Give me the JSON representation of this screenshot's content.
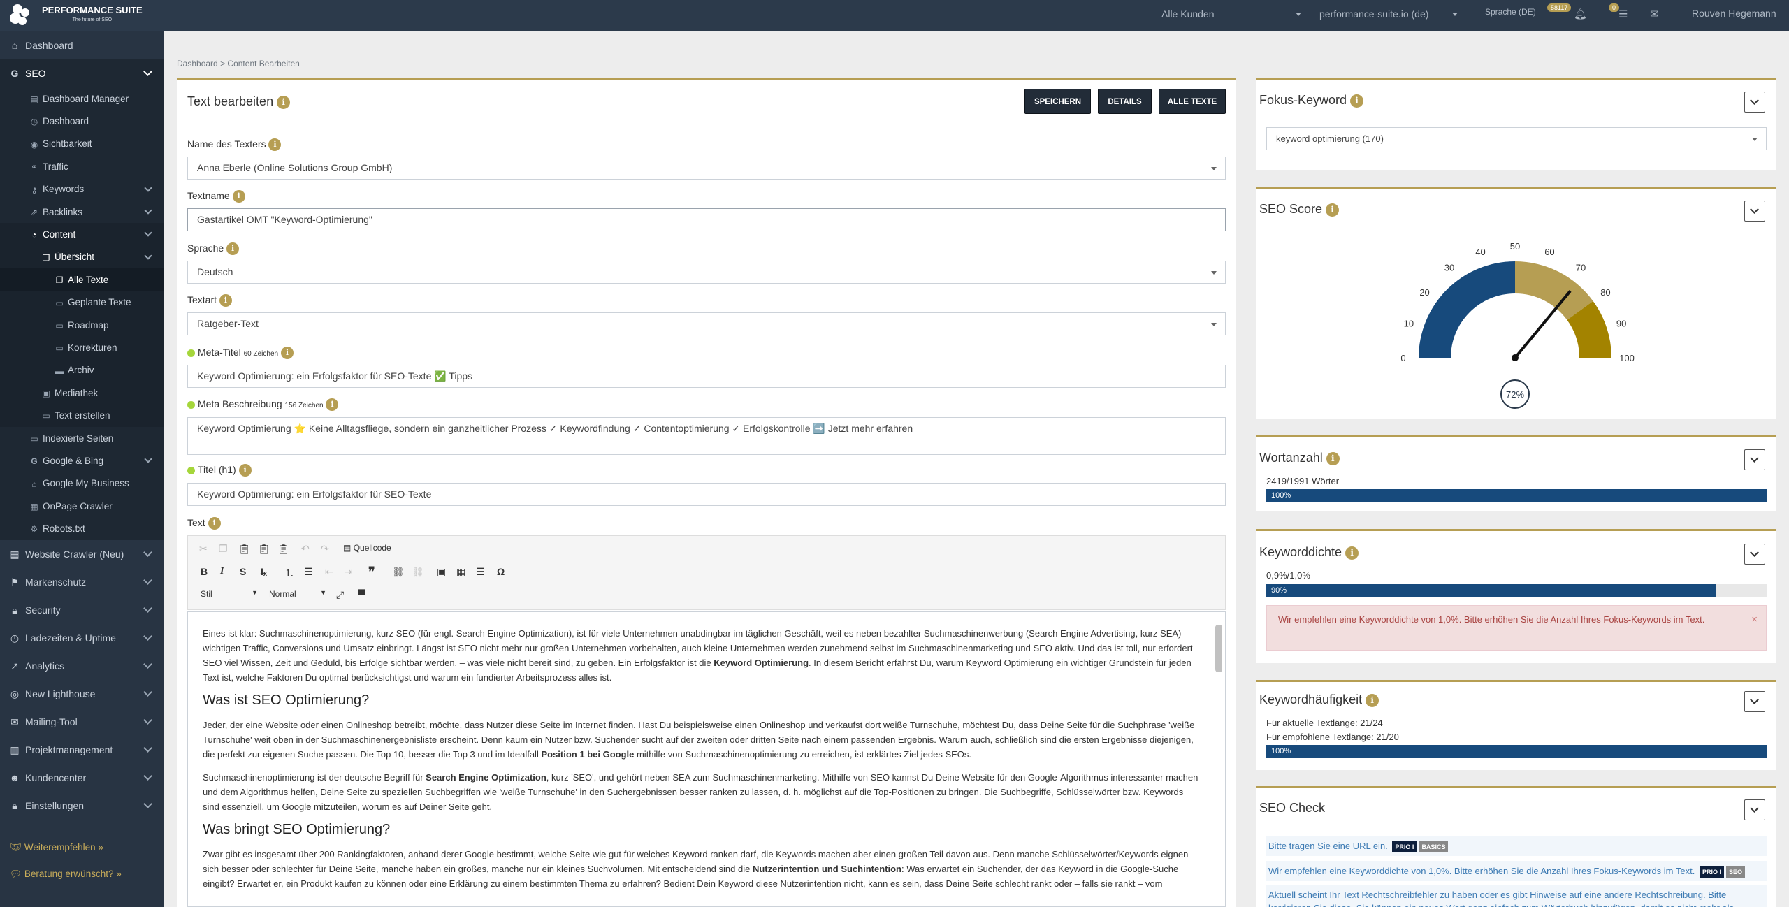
{
  "topbar": {
    "brand": "PERFORMANCE SUITE",
    "tagline": "The future of SEO",
    "customer_select": "Alle Kunden",
    "domain_select": "performance-suite.io (de)",
    "language": "Sprache (DE)",
    "bell_badge": "58117",
    "tasks_badge": "0",
    "user": "Rouven Hegemann"
  },
  "sidebar": {
    "top": [
      {
        "label": "Dashboard",
        "icon": "home-icon"
      },
      {
        "label": "SEO",
        "icon": "google-icon"
      }
    ],
    "seo_items": [
      {
        "label": "Dashboard Manager",
        "icon": "bars-icon"
      },
      {
        "label": "Dashboard",
        "icon": "gauge-icon"
      },
      {
        "label": "Sichtbarkeit",
        "icon": "eye-icon"
      },
      {
        "label": "Traffic",
        "icon": "traffic-icon"
      },
      {
        "label": "Keywords",
        "icon": "key-icon"
      },
      {
        "label": "Backlinks",
        "icon": "external-link-icon"
      },
      {
        "label": "Content",
        "icon": "clock-icon"
      }
    ],
    "content_items": [
      {
        "label": "Übersicht",
        "icon": "files-icon"
      }
    ],
    "overview_items": [
      {
        "label": "Alle Texte",
        "icon": "files-icon"
      },
      {
        "label": "Geplante Texte",
        "icon": "file-icon"
      },
      {
        "label": "Roadmap",
        "icon": "file-icon"
      },
      {
        "label": "Korrekturen",
        "icon": "file-icon"
      },
      {
        "label": "Archiv",
        "icon": "archive-icon"
      }
    ],
    "content_items2": [
      {
        "label": "Mediathek",
        "icon": "image-icon"
      },
      {
        "label": "Text erstellen",
        "icon": "file-icon"
      }
    ],
    "seo_items2": [
      {
        "label": "Indexierte Seiten",
        "icon": "file-icon"
      },
      {
        "label": "Google & Bing",
        "icon": "google-icon"
      },
      {
        "label": "Google My Business",
        "icon": "store-icon"
      },
      {
        "label": "OnPage Crawler",
        "icon": "table-icon"
      },
      {
        "label": "Robots.txt",
        "icon": "robot-icon"
      }
    ],
    "bottom": [
      {
        "label": "Website Crawler (Neu)",
        "icon": "table-icon"
      },
      {
        "label": "Markenschutz",
        "icon": "flag-icon"
      },
      {
        "label": "Security",
        "icon": "lock-icon"
      },
      {
        "label": "Ladezeiten & Uptime",
        "icon": "gauge-icon"
      },
      {
        "label": "Analytics",
        "icon": "chart-icon"
      },
      {
        "label": "New Lighthouse",
        "icon": "globe-icon"
      },
      {
        "label": "Mailing-Tool",
        "icon": "mail-icon"
      },
      {
        "label": "Projektmanagement",
        "icon": "projects-icon"
      },
      {
        "label": "Kundencenter",
        "icon": "users-icon"
      },
      {
        "label": "Einstellungen",
        "icon": "lock-icon"
      }
    ],
    "recommend": "Weiterempfehlen »",
    "consulting": "Beratung erwünscht? »"
  },
  "breadcrumb": {
    "home": "Dashboard",
    "sep": ">",
    "current": "Content Bearbeiten"
  },
  "editor_card": {
    "title": "Text bearbeiten",
    "save": "SPEICHERN",
    "details": "DETAILS",
    "all_texts": "ALLE TEXTE",
    "writer_label": "Name des Texters",
    "writer_value": "Anna Eberle (Online Solutions Group GmbH)",
    "textname_label": "Textname",
    "textname_value": "Gastartikel OMT \"Keyword-Optimierung\"",
    "language_label": "Sprache",
    "language_value": "Deutsch",
    "texttype_label": "Textart",
    "texttype_value": "Ratgeber-Text",
    "meta_title_label": "Meta-Titel",
    "meta_title_chars": "60 Zeichen",
    "meta_title_value": "Keyword Optimierung: ein Erfolgsfaktor für SEO-Texte ✅ Tipps",
    "meta_desc_label": "Meta Beschreibung",
    "meta_desc_chars": "156 Zeichen",
    "meta_desc_value": "Keyword Optimierung ⭐ Keine Alltagsfliege, sondern ein ganzheitlicher Prozess ✓ Keywordfindung ✓ Contentoptimierung ✓ Erfolgskontrolle ➡️ Jetzt mehr erfahren",
    "h1_label": "Titel (h1)",
    "h1_value": "Keyword Optimierung: ein Erfolgsfaktor für SEO-Texte",
    "text_label": "Text"
  },
  "toolbar": {
    "source": "Quellcode",
    "style": "Stil",
    "format": "Normal"
  },
  "article": {
    "p1a": "Eines ist klar: Suchmaschinenoptimierung, kurz SEO (für engl. Search Engine Optimization), ist für viele Unternehmen unabdingbar im täglichen Geschäft, weil es neben bezahlter Suchmaschinenwerbung (Search Engine Advertising, kurz SEA) wichtigen Traffic, Conversions und Umsatz einbringt. Längst ist SEO nicht mehr nur großen Unternehmen vorbehalten, auch kleine Unternehmen werden zunehmend selbst im Suchmaschinenmarketing und SEO aktiv. Und das ist toll, nur erfordert SEO viel Wissen, Zeit und Geduld, bis Erfolge sichtbar werden, – was viele nicht bereit sind, zu geben. Ein Erfolgsfaktor ist die ",
    "p1b": "Keyword Optimierung",
    "p1c": ". In diesem Bericht erfährst Du, warum Keyword Optimierung ein wichtiger Grundstein für jeden Text ist, welche Faktoren Du optimal berücksichtigst und warum ein fundierter Arbeitsprozess alles ist.",
    "h2a": "Was ist SEO Optimierung?",
    "p2a": "Jeder, der eine Website oder einen Onlineshop betreibt, möchte, dass Nutzer diese Seite im Internet finden. Hast Du beispielsweise einen Onlineshop und verkaufst dort weiße Turnschuhe, möchtest Du, dass Deine Seite für die Suchphrase 'weiße Turnschuhe' weit oben in der Suchmaschinenergebnisliste erscheint. Denn kaum ein Nutzer bzw. Suchender sucht auf der zweiten oder dritten Seite nach einem passenden Ergebnis. Warum auch, schließlich sind die ersten Ergebnisse diejenigen, die perfekt zur eigenen Suche passen. Die Top 10, besser die Top 3 und im Idealfall ",
    "p2b": "Position 1 bei Google",
    "p2c": " mithilfe von Suchmaschinenoptimierung zu erreichen, ist erklärtes Ziel jedes SEOs.",
    "p3a": "Suchmaschinenoptimierung ist der deutsche Begriff für ",
    "p3b": "Search Engine Optimization",
    "p3c": ", kurz 'SEO', und gehört neben SEA zum Suchmaschinenmarketing. Mithilfe von SEO kannst Du Deine Website für den Google-Algorithmus interessanter machen und dem Algorithmus helfen, Deine Seite zu speziellen Suchbegriffen wie 'weiße Turnschuhe' in den Suchergebnissen besser ranken zu lassen, d. h. möglichst auf die Top-Positionen zu bringen. Die Suchbegriffe, Schlüsselwörter bzw. Keywords sind essenziell, um Google mitzuteilen, worum es auf Deiner Seite geht.",
    "h2b": "Was bringt SEO Optimierung?",
    "p4a": "Zwar gibt es insgesamt über 200 Rankingfaktoren, anhand derer Google bestimmt, welche Seite wie gut für welches Keyword ranken darf, die Keywords machen aber einen großen Teil davon aus. Denn manche Schlüsselwörter/Keywords eignen sich besser oder schlechter für Deine Seite, manche haben ein großes, manche nur ein kleines Suchvolumen. Mit entscheidend sind die ",
    "p4b": "Nutzerintention und Suchintention",
    "p4c": ": Was erwartet ein Suchender, der das Keyword in die Google-Suche eingibt? Erwartet er, ein Produkt kaufen zu können oder eine Erklärung zu einem bestimmten Thema zu erfahren? Bedient Dein Keyword diese Nutzerintention nicht, kann es sein, dass Deine Seite schlecht rankt oder – falls sie rankt – vom"
  },
  "focus": {
    "title": "Fokus-Keyword",
    "value": "keyword optimierung (170)"
  },
  "score": {
    "title": "SEO Score",
    "value": "72%",
    "ticks": [
      "0",
      "10",
      "20",
      "30",
      "40",
      "50",
      "60",
      "70",
      "80",
      "90",
      "100"
    ]
  },
  "gauge_data": {
    "value": 72,
    "min": 0,
    "max": 100
  },
  "words": {
    "title": "Wortanzahl",
    "info": "2419/1991 Wörter",
    "bar": "100%",
    "level": 1.0
  },
  "density": {
    "title": "Keyworddichte",
    "info": "0,9%/1,0%",
    "bar": "90%",
    "level": 0.9,
    "alert": "Wir empfehlen eine Keyworddichte von 1,0%. Bitte erhöhen Sie die Anzahl Ihres Fokus-Keywords im Text.",
    "close": "×"
  },
  "frequency": {
    "title": "Keywordhäufigkeit",
    "current": "Für aktuelle Textlänge: 21/24",
    "recommended": "Für empfohlene Textlänge: 21/20",
    "bar": "100%",
    "level": 1.0
  },
  "check": {
    "title": "SEO Check",
    "item1": "Bitte tragen Sie eine URL ein.",
    "item1_tag1": "PRIO I",
    "item1_tag2": "BASICS",
    "item2": "Wir empfehlen eine Keyworddichte von 1,0%. Bitte erhöhen Sie die Anzahl Ihres Fokus-Keywords im Text.",
    "item2_tag1": "PRIO I",
    "item2_tag2": "SEO",
    "item3": "Aktuell scheint Ihr Text Rechtschreibfehler zu haben oder es gibt Hinweise auf eine andere Rechtschreibung. Bitte korrigieren Sie diese. Sie können ein neues Wort ganz einfach zum Wörterbuch hinzufügen, damit es nicht mehr als"
  },
  "colors": {
    "accent": "#b69e53",
    "sidebar": "#283443",
    "primary_bar": "#174a7c",
    "gauge_blue": "#174a7c",
    "gauge_gold": "#b69e53",
    "gauge_dark_gold": "#a38300"
  }
}
